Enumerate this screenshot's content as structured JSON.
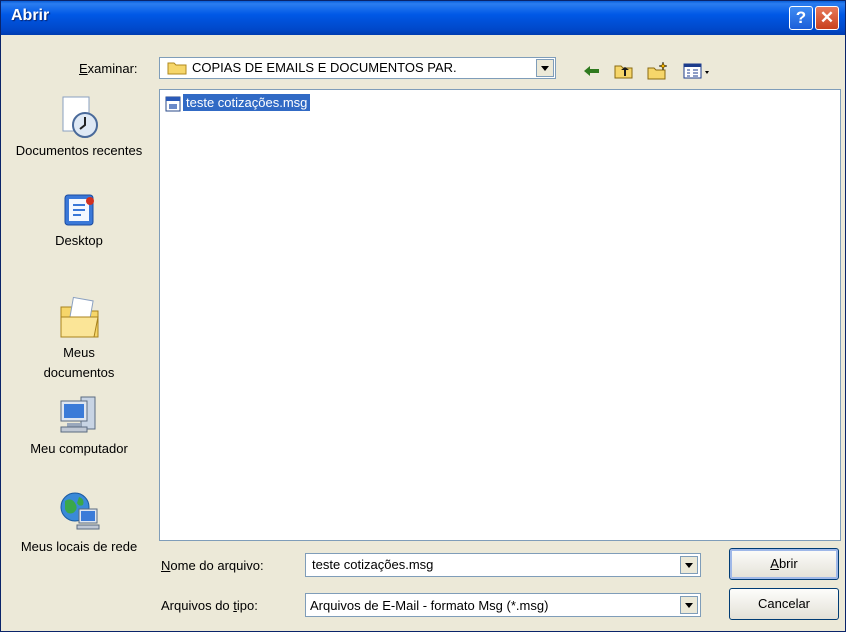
{
  "window": {
    "title": "Abrir",
    "help_glyph": "?",
    "close_glyph": "✕"
  },
  "lookin": {
    "label_u": "E",
    "label_rest": "xaminar:",
    "value": "COPIAS DE EMAILS E DOCUMENTOS PAR."
  },
  "toolbar": {
    "icons": [
      "back-arrow-icon",
      "up-one-level-icon",
      "create-new-folder-icon",
      "view-menu-icon"
    ]
  },
  "places": [
    {
      "label": "Documentos recentes",
      "icon": "recent-documents-icon"
    },
    {
      "label": "Desktop",
      "icon": "desktop-icon"
    },
    {
      "label": "Meus documentos",
      "icon": "my-documents-icon"
    },
    {
      "label": "Meu computador",
      "icon": "my-computer-icon"
    },
    {
      "label": "Meus locais de rede",
      "icon": "network-places-icon"
    }
  ],
  "files": [
    {
      "name": "teste cotizações.msg",
      "icon": "msg-file-icon",
      "selected": true
    }
  ],
  "filename": {
    "label_u": "N",
    "label_rest": "ome do arquivo:",
    "value": "teste cotizações.msg"
  },
  "filetype": {
    "label_pre": "Arquivos do ",
    "label_u": "t",
    "label_rest": "ipo:",
    "value": "Arquivos de E-Mail - formato Msg (*.msg)"
  },
  "buttons": {
    "open_u": "A",
    "open_rest": "brir",
    "cancel": "Cancelar"
  },
  "colors": {
    "titlebar": "#0058e6",
    "selection": "#316ac5",
    "face": "#ece9d8"
  }
}
